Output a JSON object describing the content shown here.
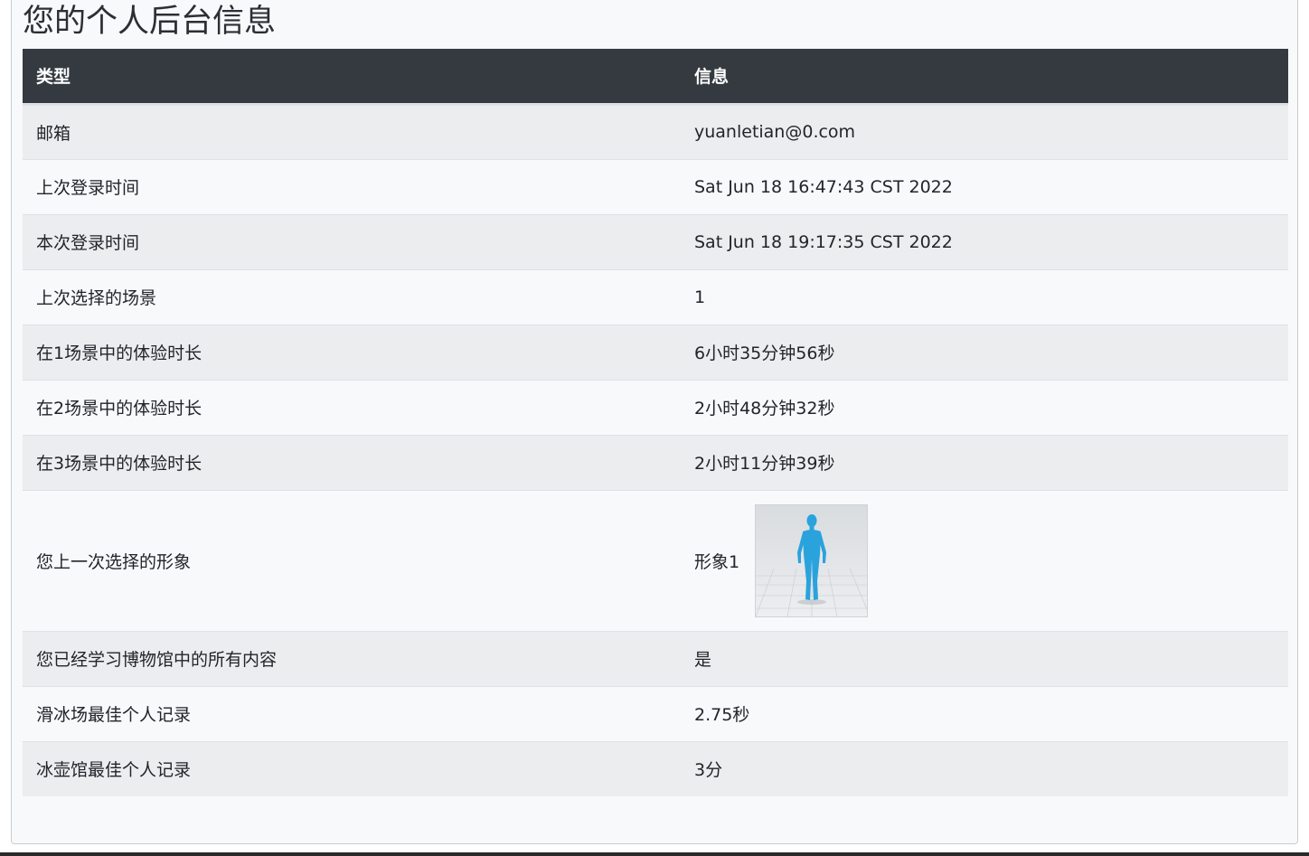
{
  "page": {
    "title": "您的个人后台信息"
  },
  "table": {
    "headers": [
      "类型",
      "信息"
    ],
    "rows": [
      {
        "type": "邮箱",
        "info": "yuanletian@0.com"
      },
      {
        "type": "上次登录时间",
        "info": "Sat Jun 18 16:47:43 CST 2022"
      },
      {
        "type": "本次登录时间",
        "info": "Sat Jun 18 19:17:35 CST 2022"
      },
      {
        "type": "上次选择的场景",
        "info": "1"
      },
      {
        "type": "在1场景中的体验时长",
        "info": "6小时35分钟56秒"
      },
      {
        "type": "在2场景中的体验时长",
        "info": "2小时48分钟32秒"
      },
      {
        "type": "在3场景中的体验时长",
        "info": "2小时11分钟39秒"
      },
      {
        "type": "您上一次选择的形象",
        "info": "形象1"
      },
      {
        "type": "您已经学习博物馆中的所有内容",
        "info": "是"
      },
      {
        "type": "滑冰场最佳个人记录",
        "info": "2.75秒"
      },
      {
        "type": "冰壶馆最佳个人记录",
        "info": "3分"
      }
    ]
  },
  "avatar": {
    "icon": "human-figure-icon",
    "color": "#2aa3dd"
  },
  "colors": {
    "header_bg": "#343a40",
    "stripe": "#ecedef",
    "panel_bg": "#f7f9fb"
  }
}
